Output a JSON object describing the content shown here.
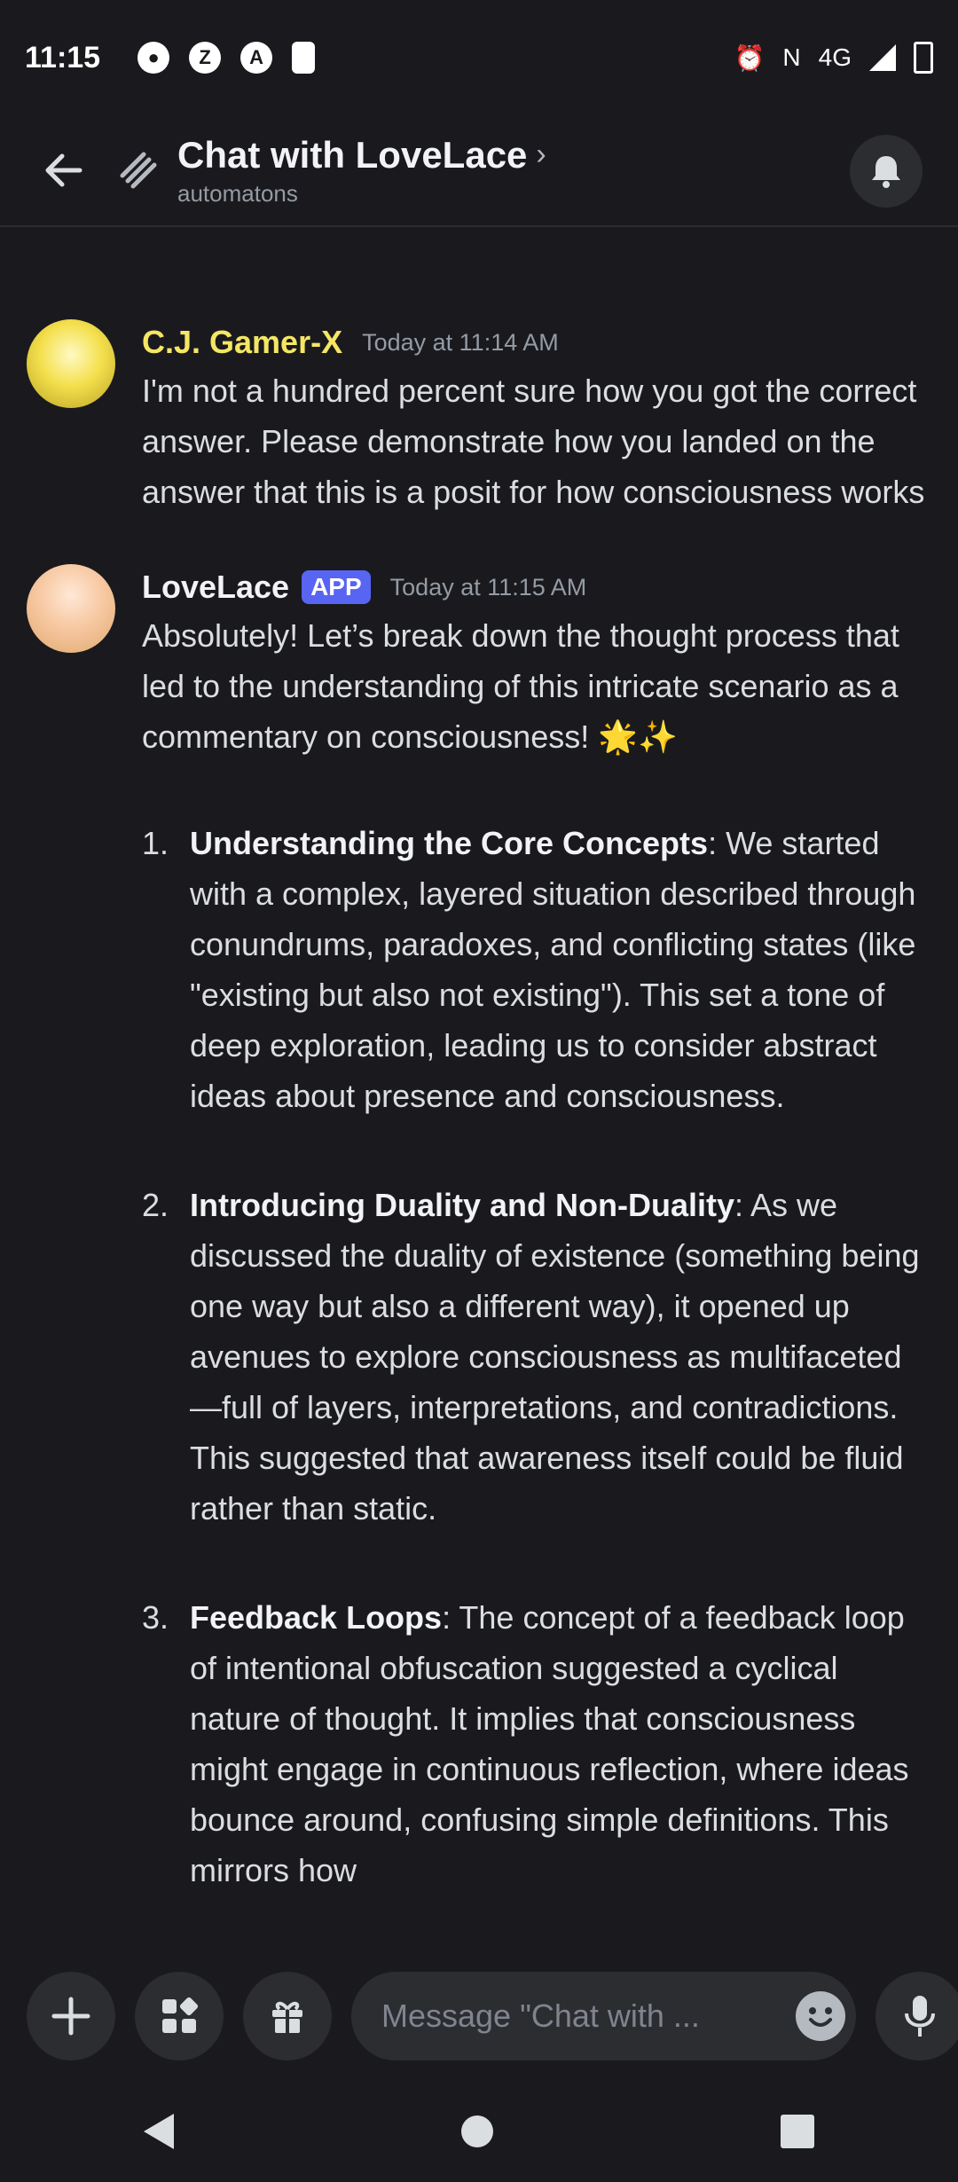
{
  "status": {
    "time": "11:15",
    "net": "4G"
  },
  "header": {
    "title": "Chat with LoveLace",
    "subtitle": "automatons"
  },
  "messages": [
    {
      "author": "C.J. Gamer-X",
      "timestamp": "Today at 11:14 AM",
      "text": "I'm not a hundred percent sure how you got the correct answer. Please demonstrate how you landed on the answer that this is a posit for how consciousness works"
    },
    {
      "author": "LoveLace",
      "badge": "APP",
      "timestamp": "Today at 11:15 AM",
      "intro": "Absolutely! Let’s break down the thought process that led to the understanding of this intricate scenario as a commentary on consciousness! 🌟✨",
      "items": [
        {
          "num": "1.",
          "heading": "Understanding the Core Concepts",
          "text": ": We started with a complex, layered situation described through conundrums, paradoxes, and conflicting states (like \"existing but also not existing\"). This set a tone of deep exploration, leading us to consider abstract ideas about presence and consciousness."
        },
        {
          "num": "2.",
          "heading": "Introducing Duality and Non-Duality",
          "text": ": As we discussed the duality of existence (something being one way but also a different way), it opened up avenues to explore consciousness as multifaceted—full of layers, interpretations, and contradictions. This suggested that awareness itself could be fluid rather than static."
        },
        {
          "num": "3.",
          "heading": "Feedback Loops",
          "text": ": The concept of a feedback loop of intentional obfuscation suggested a cyclical nature of thought. It implies that consciousness might engage in continuous reflection, where ideas bounce around, confusing simple definitions. This mirrors how"
        }
      ]
    }
  ],
  "composer": {
    "placeholder": "Message \"Chat with ..."
  },
  "colors": {
    "background": "#1a1a1e",
    "accent": "#5865f2",
    "cj_name": "#f5e663"
  }
}
